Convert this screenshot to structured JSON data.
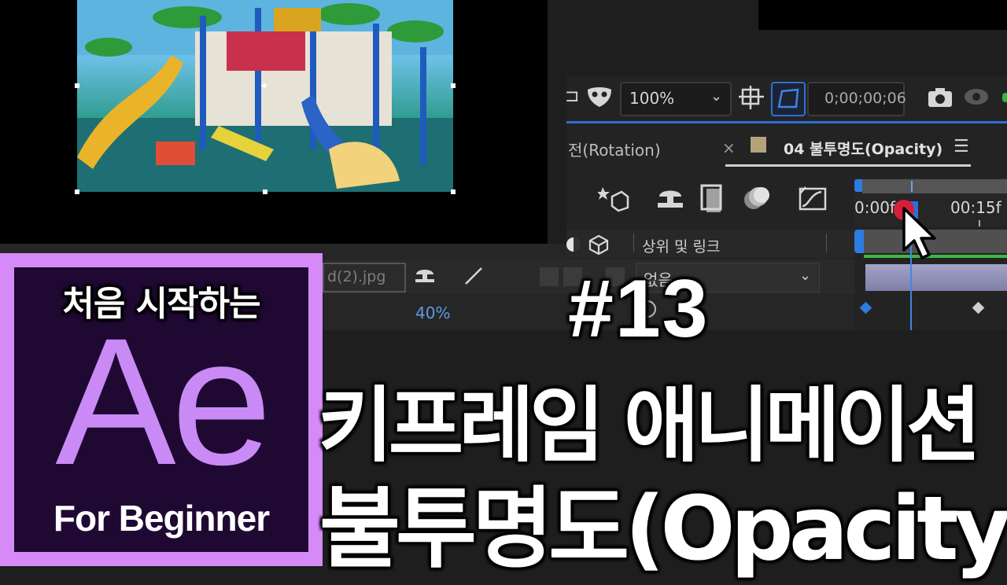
{
  "viewer": {
    "zoom": "100%",
    "timecode": "0;00;00;06"
  },
  "timeline": {
    "tab_rotation": "전(Rotation)",
    "tab_close": "×",
    "tab_opacity": "04 불투명도(Opacity)",
    "tab_menu": "☰",
    "parent_link_label": "상위 및 링크",
    "ruler_label_start": "0:00f",
    "ruler_label_15": "00:15f"
  },
  "layer": {
    "name": "d(2).jpg",
    "opacity_value": "40%",
    "parent_value": "없음"
  },
  "badge": {
    "top_text": "처음 시작하는",
    "logo_text": "Ae",
    "bottom_text": "For Beginner",
    "border_color": "#d58af8",
    "bg_color": "#1f0933"
  },
  "headline": {
    "episode": "#13",
    "line1": "키프레임 애니메이션",
    "line2": "불투명도(Opacity)"
  },
  "icons": {
    "mask": "mask-icon",
    "region": "region-of-interest-icon",
    "transparency": "transparency-grid-icon",
    "camera": "snapshot-camera-icon",
    "eye": "show-snapshot-icon",
    "shy": "shy-icon",
    "frame_blend": "frame-blend-icon",
    "motion_blur": "motion-blur-icon",
    "graph_editor": "graph-editor-icon",
    "composition_flowchart": "comp-mini-flowchart-icon"
  }
}
